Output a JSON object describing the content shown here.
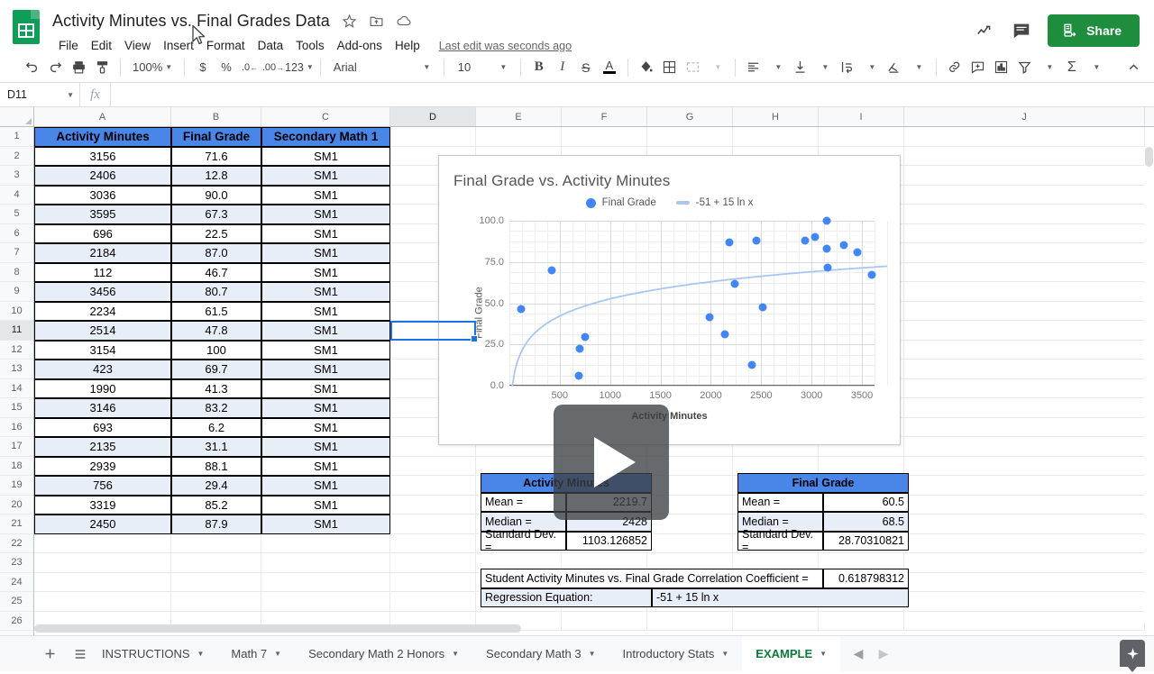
{
  "app": {
    "title": "Activity Minutes vs. Final Grades Data",
    "last_edit": "Last edit was seconds ago",
    "share_label": "Share",
    "logo_name": "google-sheets-logo"
  },
  "menubar": {
    "items": [
      "File",
      "Edit",
      "View",
      "Insert",
      "Format",
      "Data",
      "Tools",
      "Add-ons",
      "Help"
    ]
  },
  "toolbar": {
    "zoom": "100%",
    "font": "Arial",
    "font_size": "10",
    "number_format": "123",
    "percent": "%",
    "currency": "$",
    "dec_decrease": ".0",
    "dec_increase": ".00"
  },
  "formula_bar": {
    "name_box": "D11",
    "fx": "fx",
    "value": ""
  },
  "grid": {
    "columns": [
      "A",
      "B",
      "C",
      "D",
      "E",
      "F",
      "G",
      "H",
      "I",
      "J"
    ],
    "active_column": "D",
    "active_row": 11,
    "rows": [
      1,
      2,
      3,
      4,
      5,
      6,
      7,
      8,
      9,
      10,
      11,
      12,
      13,
      14,
      15,
      16,
      17,
      18,
      19,
      20,
      21,
      22,
      23,
      24,
      25,
      26
    ],
    "headers": [
      "Activity Minutes",
      "Final Grade",
      "Secondary Math 1"
    ],
    "data": [
      [
        "3156",
        "71.6",
        "SM1"
      ],
      [
        "2406",
        "12.8",
        "SM1"
      ],
      [
        "3036",
        "90.0",
        "SM1"
      ],
      [
        "3595",
        "67.3",
        "SM1"
      ],
      [
        "696",
        "22.5",
        "SM1"
      ],
      [
        "2184",
        "87.0",
        "SM1"
      ],
      [
        "112",
        "46.7",
        "SM1"
      ],
      [
        "3456",
        "80.7",
        "SM1"
      ],
      [
        "2234",
        "61.5",
        "SM1"
      ],
      [
        "2514",
        "47.8",
        "SM1"
      ],
      [
        "3154",
        "100",
        "SM1"
      ],
      [
        "423",
        "69.7",
        "SM1"
      ],
      [
        "1990",
        "41.3",
        "SM1"
      ],
      [
        "3146",
        "83.2",
        "SM1"
      ],
      [
        "693",
        "6.2",
        "SM1"
      ],
      [
        "2135",
        "31.1",
        "SM1"
      ],
      [
        "2939",
        "88.1",
        "SM1"
      ],
      [
        "756",
        "29.4",
        "SM1"
      ],
      [
        "3319",
        "85.2",
        "SM1"
      ],
      [
        "2450",
        "87.9",
        "SM1"
      ]
    ]
  },
  "stats": {
    "activity": {
      "title": "Activity Minutes",
      "rows": [
        {
          "label": "Mean =",
          "value": "2219.7"
        },
        {
          "label": "Median =",
          "value": "2428"
        },
        {
          "label": "Standard Dev. =",
          "value": "1103.126852"
        }
      ]
    },
    "grade": {
      "title": "Final Grade",
      "rows": [
        {
          "label": "Mean =",
          "value": "60.5"
        },
        {
          "label": "Median =",
          "value": "68.5"
        },
        {
          "label": "Standard Dev. =",
          "value": "28.70310821"
        }
      ]
    },
    "correlation": {
      "label": "Student Activity Minutes vs. Final Grade Correlation Coefficient =",
      "value": "0.618798312"
    },
    "regression": {
      "label": "Regression Equation:",
      "value": "-51 + 15 ln x"
    }
  },
  "chart_data": {
    "type": "scatter",
    "title": "Final Grade vs. Activity Minutes",
    "xlabel": "Activity Minutes",
    "ylabel": "Final Grade",
    "xlim": [
      0,
      3750
    ],
    "ylim": [
      0,
      100
    ],
    "xticks": [
      "500",
      "1000",
      "1500",
      "2000",
      "2500",
      "3000",
      "3500"
    ],
    "xtick_values": [
      500,
      1000,
      1500,
      2000,
      2500,
      3000,
      3500
    ],
    "yticks": [
      "0.0",
      "25.0",
      "50.0",
      "75.0",
      "100.0"
    ],
    "ytick_values": [
      0,
      25,
      50,
      75,
      100
    ],
    "grid": true,
    "legend_position": "top",
    "legend": [
      {
        "name": "Final Grade",
        "marker": "dot",
        "color": "#4285f4"
      },
      {
        "name": "-51 + 15 ln x",
        "marker": "line",
        "color": "#a7c7f2"
      }
    ],
    "series": [
      {
        "name": "Final Grade",
        "color": "#4285f4",
        "points": [
          {
            "x": 3156,
            "y": 71.6
          },
          {
            "x": 2406,
            "y": 12.8
          },
          {
            "x": 3036,
            "y": 90.0
          },
          {
            "x": 3595,
            "y": 67.3
          },
          {
            "x": 696,
            "y": 22.5
          },
          {
            "x": 2184,
            "y": 87.0
          },
          {
            "x": 112,
            "y": 46.7
          },
          {
            "x": 3456,
            "y": 80.7
          },
          {
            "x": 2234,
            "y": 61.5
          },
          {
            "x": 2514,
            "y": 47.8
          },
          {
            "x": 3154,
            "y": 100
          },
          {
            "x": 423,
            "y": 69.7
          },
          {
            "x": 1990,
            "y": 41.3
          },
          {
            "x": 3146,
            "y": 83.2
          },
          {
            "x": 693,
            "y": 6.2
          },
          {
            "x": 2135,
            "y": 31.1
          },
          {
            "x": 2939,
            "y": 88.1
          },
          {
            "x": 756,
            "y": 29.4
          },
          {
            "x": 3319,
            "y": 85.2
          },
          {
            "x": 2450,
            "y": 87.9
          }
        ]
      }
    ],
    "trendline": {
      "name": "-51 + 15 ln x",
      "color": "#a7c7f2",
      "equation": "-51 + 15 ln x",
      "intercept": -51,
      "coefficient": 15,
      "form": "logarithmic"
    }
  },
  "video_overlay": {
    "play_label": "play-button"
  },
  "sheetbar": {
    "add_label": "+",
    "all_sheets_label": "all-sheets",
    "tabs": [
      {
        "label": "INSTRUCTIONS",
        "active": false
      },
      {
        "label": "Math 7",
        "active": false
      },
      {
        "label": "Secondary Math 2 Honors",
        "active": false
      },
      {
        "label": "Secondary Math 3",
        "active": false
      },
      {
        "label": "Introductory Stats",
        "active": false
      },
      {
        "label": "EXAMPLE",
        "active": true
      }
    ]
  }
}
